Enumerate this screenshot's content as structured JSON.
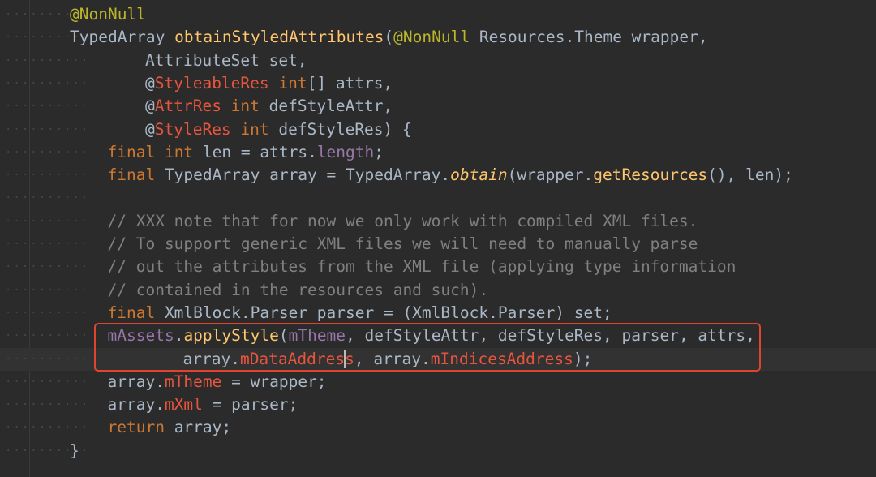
{
  "editor": {
    "lines": [
      {
        "indent": 0,
        "tokens": [
          {
            "t": "ann",
            "v": "@NonNull"
          }
        ]
      },
      {
        "indent": 0,
        "tokens": [
          {
            "t": "plain",
            "v": "TypedArray "
          },
          {
            "t": "method",
            "v": "obtainStyledAttributes"
          },
          {
            "t": "plain",
            "v": "("
          },
          {
            "t": "ann",
            "v": "@NonNull"
          },
          {
            "t": "plain",
            "v": " Resources.Theme wrapper,"
          }
        ]
      },
      {
        "indent": 2,
        "tokens": [
          {
            "t": "plain",
            "v": "AttributeSet set,"
          }
        ]
      },
      {
        "indent": 2,
        "tokens": [
          {
            "t": "plain",
            "v": "@"
          },
          {
            "t": "annred",
            "v": "StyleableRes"
          },
          {
            "t": "plain",
            "v": " "
          },
          {
            "t": "kw",
            "v": "int"
          },
          {
            "t": "plain",
            "v": "[] attrs,"
          }
        ]
      },
      {
        "indent": 2,
        "tokens": [
          {
            "t": "plain",
            "v": "@"
          },
          {
            "t": "annred",
            "v": "AttrRes"
          },
          {
            "t": "plain",
            "v": " "
          },
          {
            "t": "kw",
            "v": "int"
          },
          {
            "t": "plain",
            "v": " defStyleAttr,"
          }
        ]
      },
      {
        "indent": 2,
        "tokens": [
          {
            "t": "plain",
            "v": "@"
          },
          {
            "t": "annred",
            "v": "StyleRes"
          },
          {
            "t": "plain",
            "v": " "
          },
          {
            "t": "kw",
            "v": "int"
          },
          {
            "t": "plain",
            "v": " defStyleRes) {"
          }
        ]
      },
      {
        "indent": 1,
        "tokens": [
          {
            "t": "kw",
            "v": "final"
          },
          {
            "t": "plain",
            "v": " "
          },
          {
            "t": "kw",
            "v": "int"
          },
          {
            "t": "plain",
            "v": " len = attrs."
          },
          {
            "t": "field",
            "v": "length"
          },
          {
            "t": "plain",
            "v": ";"
          }
        ]
      },
      {
        "indent": 1,
        "tokens": [
          {
            "t": "kw",
            "v": "final"
          },
          {
            "t": "plain",
            "v": " TypedArray array = TypedArray."
          },
          {
            "t": "static",
            "v": "obtain"
          },
          {
            "t": "plain",
            "v": "(wrapper."
          },
          {
            "t": "method",
            "v": "getResources"
          },
          {
            "t": "plain",
            "v": "(), len);"
          }
        ]
      },
      {
        "indent": 0,
        "tokens": []
      },
      {
        "indent": 1,
        "tokens": [
          {
            "t": "comment",
            "v": "// XXX note that for now we only work with compiled XML files."
          }
        ]
      },
      {
        "indent": 1,
        "tokens": [
          {
            "t": "comment",
            "v": "// To support generic XML files we will need to manually parse"
          }
        ]
      },
      {
        "indent": 1,
        "tokens": [
          {
            "t": "comment",
            "v": "// out the attributes from the XML file (applying type information"
          }
        ]
      },
      {
        "indent": 1,
        "tokens": [
          {
            "t": "comment",
            "v": "// contained in the resources and such)."
          }
        ]
      },
      {
        "indent": 1,
        "tokens": [
          {
            "t": "kw",
            "v": "final"
          },
          {
            "t": "plain",
            "v": " XmlBlock.Parser parser = (XmlBlock.Parser) set;"
          }
        ]
      },
      {
        "indent": 1,
        "tokens": [
          {
            "t": "field",
            "v": "mAssets"
          },
          {
            "t": "plain",
            "v": "."
          },
          {
            "t": "method",
            "v": "applyStyle"
          },
          {
            "t": "plain",
            "v": "("
          },
          {
            "t": "field",
            "v": "mTheme"
          },
          {
            "t": "plain",
            "v": ", defStyleAttr, defStyleRes, parser, attrs,"
          }
        ]
      },
      {
        "indent": 3,
        "current": true,
        "tokens": [
          {
            "t": "plain",
            "v": "array."
          },
          {
            "t": "annred",
            "v": "mDataAddres"
          },
          {
            "t": "caret",
            "v": ""
          },
          {
            "t": "annred",
            "v": "s"
          },
          {
            "t": "plain",
            "v": ", array."
          },
          {
            "t": "annred",
            "v": "mIndicesAddress"
          },
          {
            "t": "plain",
            "v": ");"
          }
        ]
      },
      {
        "indent": 1,
        "tokens": [
          {
            "t": "plain",
            "v": "array."
          },
          {
            "t": "annred",
            "v": "mTheme"
          },
          {
            "t": "plain",
            "v": " = wrapper;"
          }
        ]
      },
      {
        "indent": 1,
        "tokens": [
          {
            "t": "plain",
            "v": "array."
          },
          {
            "t": "annred",
            "v": "mXml"
          },
          {
            "t": "plain",
            "v": " = parser;"
          }
        ]
      },
      {
        "indent": 1,
        "tokens": [
          {
            "t": "kw",
            "v": "return"
          },
          {
            "t": "plain",
            "v": " array;"
          }
        ]
      },
      {
        "indent": 0,
        "tokens": [
          {
            "t": "plain",
            "v": "}"
          }
        ]
      }
    ],
    "highlight_color": "#e0442e",
    "background": "#2b2b2b"
  }
}
